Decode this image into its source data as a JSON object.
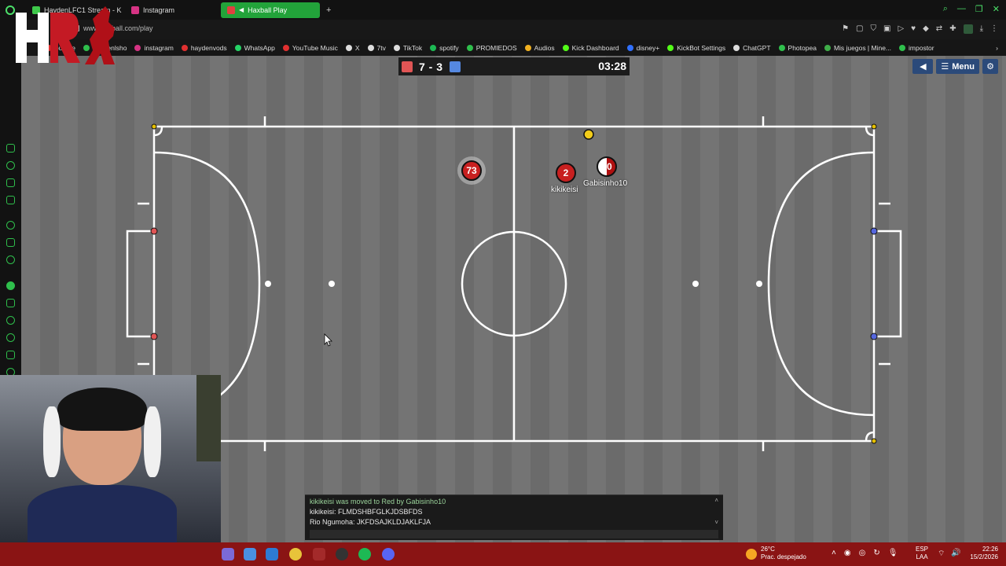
{
  "browser": {
    "tabs": [
      {
        "label": "HaydenLFC1 Stream - K",
        "color": "#3ec84a"
      },
      {
        "label": "Instagram",
        "color": "#d63384"
      },
      {
        "label": "Haxball Play",
        "color": "#e04040"
      }
    ],
    "new_tab_icon": "plus-icon",
    "address": "www.haxball.com/play",
    "bookmarks": [
      {
        "label": "outube",
        "color": "#e03030"
      },
      {
        "label": "haydenlsho",
        "color": "#2fbf4c"
      },
      {
        "label": "instagram",
        "color": "#d63384"
      },
      {
        "label": "haydenvods",
        "color": "#e03030"
      },
      {
        "label": "WhatsApp",
        "color": "#25d366"
      },
      {
        "label": "YouTube Music",
        "color": "#e03030"
      },
      {
        "label": "X",
        "color": "#dddddd"
      },
      {
        "label": "7tv",
        "color": "#dddddd"
      },
      {
        "label": "TikTok",
        "color": "#dddddd"
      },
      {
        "label": "spotify",
        "color": "#1db954"
      },
      {
        "label": "PROMIEDOS",
        "color": "#2fbf4c"
      },
      {
        "label": "Audios",
        "color": "#f0b020"
      },
      {
        "label": "Kick Dashboard",
        "color": "#53fc18"
      },
      {
        "label": "disney+",
        "color": "#3070ff"
      },
      {
        "label": "KickBot Settings",
        "color": "#53fc18"
      },
      {
        "label": "ChatGPT",
        "color": "#dddddd"
      },
      {
        "label": "Photopea",
        "color": "#2fbf4c"
      },
      {
        "label": "Mis juegos | Mine...",
        "color": "#3fae49"
      },
      {
        "label": "impostor",
        "color": "#2fbf4c"
      }
    ]
  },
  "game": {
    "score": "7 - 3",
    "timer": "03:28",
    "red_color": "#e05555",
    "blue_color": "#5588e0",
    "menu_label": "Menu",
    "players": [
      {
        "number": "73",
        "name": ""
      },
      {
        "number": "2",
        "name": "kikikeisi"
      },
      {
        "number": "10",
        "name": "Gabisinho10"
      }
    ]
  },
  "chat": {
    "lines": [
      "kikikeisi was moved to Red by Gabisinho10",
      "kikikeisi: FLMDSHBFGLKJDSBFDS",
      "Rio Ngumoha: JKFDSAJKLDJAKLFJA"
    ]
  },
  "taskbar": {
    "temperature": "26°C",
    "weather": "Prac. despejado",
    "lang_top": "ESP",
    "lang_bottom": "LAA",
    "time": "22:26",
    "date": "15/2/2026"
  }
}
